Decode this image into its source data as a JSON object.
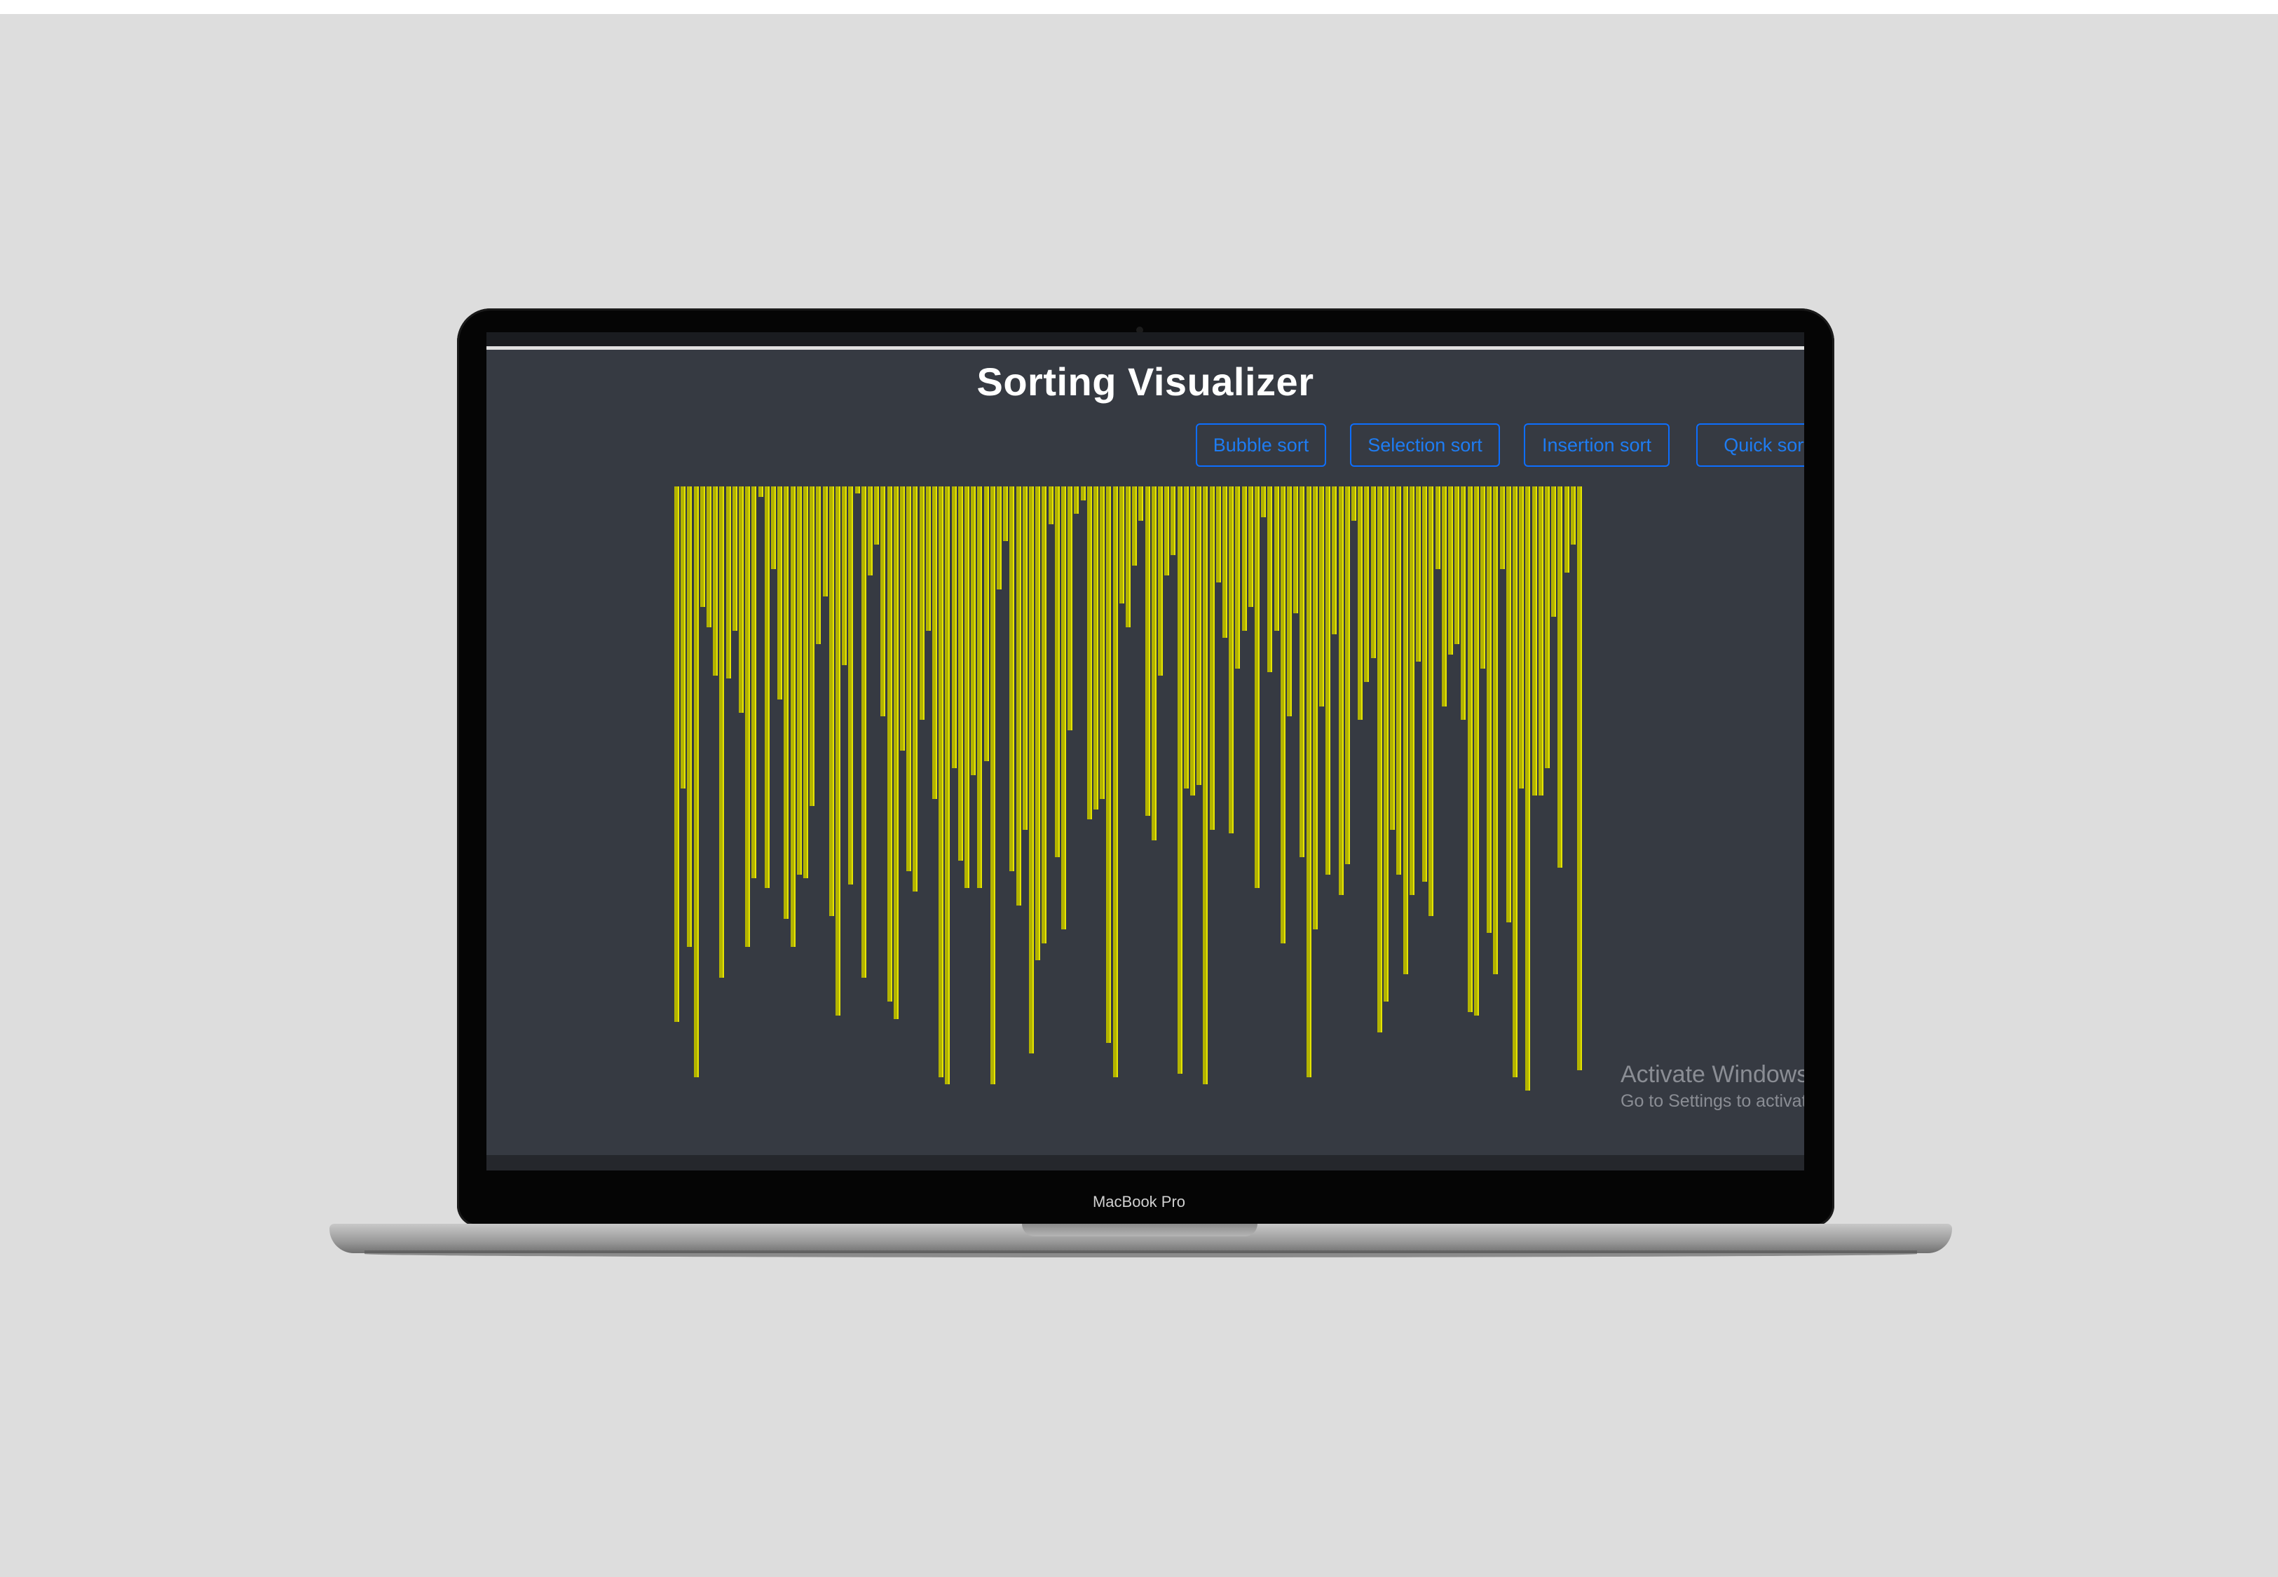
{
  "app": {
    "title": "Sorting Visualizer"
  },
  "buttons": {
    "bubble": "Bubble sort",
    "selection": "Selection sort",
    "insertion": "Insertion sort",
    "quick": "Quick sort"
  },
  "array": {
    "bar_color": "#b3b300",
    "values": [
      780,
      440,
      670,
      860,
      175,
      205,
      275,
      715,
      280,
      210,
      330,
      670,
      570,
      15,
      585,
      120,
      310,
      630,
      670,
      565,
      570,
      465,
      230,
      160,
      625,
      770,
      260,
      580,
      10,
      715,
      130,
      85,
      335,
      750,
      775,
      385,
      560,
      590,
      340,
      210,
      455,
      860,
      870,
      410,
      545,
      585,
      420,
      585,
      400,
      870,
      150,
      80,
      560,
      610,
      500,
      825,
      690,
      665,
      55,
      540,
      645,
      355,
      40,
      20,
      485,
      470,
      455,
      810,
      860,
      170,
      205,
      115,
      50,
      480,
      515,
      275,
      130,
      100,
      855,
      440,
      450,
      435,
      870,
      500,
      140,
      220,
      505,
      265,
      210,
      175,
      585,
      45,
      270,
      210,
      665,
      335,
      185,
      540,
      860,
      645,
      320,
      565,
      215,
      595,
      550,
      50,
      340,
      285,
      250,
      795,
      750,
      500,
      565,
      710,
      595,
      255,
      575,
      625,
      120,
      320,
      245,
      230,
      340,
      765,
      770,
      265,
      650,
      710,
      120,
      635,
      860,
      440,
      880,
      450,
      450,
      410,
      190,
      555,
      125,
      85,
      850
    ],
    "marked_index": 49
  },
  "watermark": {
    "line1": "Activate Windows",
    "line2": "Go to Settings to activate Windows."
  },
  "device": {
    "label": "MacBook Pro"
  }
}
